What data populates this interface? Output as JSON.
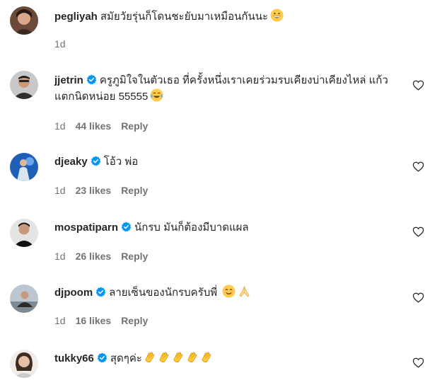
{
  "comments": [
    {
      "username": "pegliyah",
      "verified": false,
      "text": "สมัยวัยรุ่นก็โดนชะยับมาเหมือนกันนะ",
      "emojis": [
        "grinning-face"
      ],
      "time": "1d",
      "likes": "",
      "reply": "",
      "avatar": "user-avatar-pegliyah"
    },
    {
      "username": "jjetrin",
      "verified": true,
      "text": "ครูภูมิใจในตัวเธอ ที่ครั้งหนึ่งเราเคยร่วมรบเคียงบ่าเคียงไหล่ แก้วแตกนิดหน่อย 55555",
      "emojis": [
        "tears-of-joy"
      ],
      "time": "1d",
      "likes": "44 likes",
      "reply": "Reply",
      "avatar": "user-avatar-jjetrin"
    },
    {
      "username": "djeaky",
      "verified": true,
      "text": "โอ้ว พ่อ",
      "emojis": [],
      "time": "1d",
      "likes": "23 likes",
      "reply": "Reply",
      "avatar": "user-avatar-djeaky"
    },
    {
      "username": "mospatiparn",
      "verified": true,
      "text": "นักรบ มันก็ต้องมีบาดแผล",
      "emojis": [],
      "time": "1d",
      "likes": "26 likes",
      "reply": "Reply",
      "avatar": "user-avatar-mospatiparn"
    },
    {
      "username": "djpoom",
      "verified": true,
      "text": "ลายเซ็นของนักรบครับพี่",
      "emojis": [
        "smiling-face",
        "folded-hands"
      ],
      "time": "1d",
      "likes": "16 likes",
      "reply": "Reply",
      "avatar": "user-avatar-djpoom"
    },
    {
      "username": "tukky66",
      "verified": true,
      "text": "สุดๆค่ะ",
      "emojis": [
        "clapping-hands",
        "clapping-hands",
        "clapping-hands",
        "clapping-hands",
        "clapping-hands"
      ],
      "time": "",
      "likes": "",
      "reply": "",
      "avatar": "user-avatar-tukky66"
    }
  ],
  "colors": {
    "text": "#262626",
    "meta": "#737373",
    "verified": "#0095f6",
    "emoji": "#ffcc4d"
  }
}
